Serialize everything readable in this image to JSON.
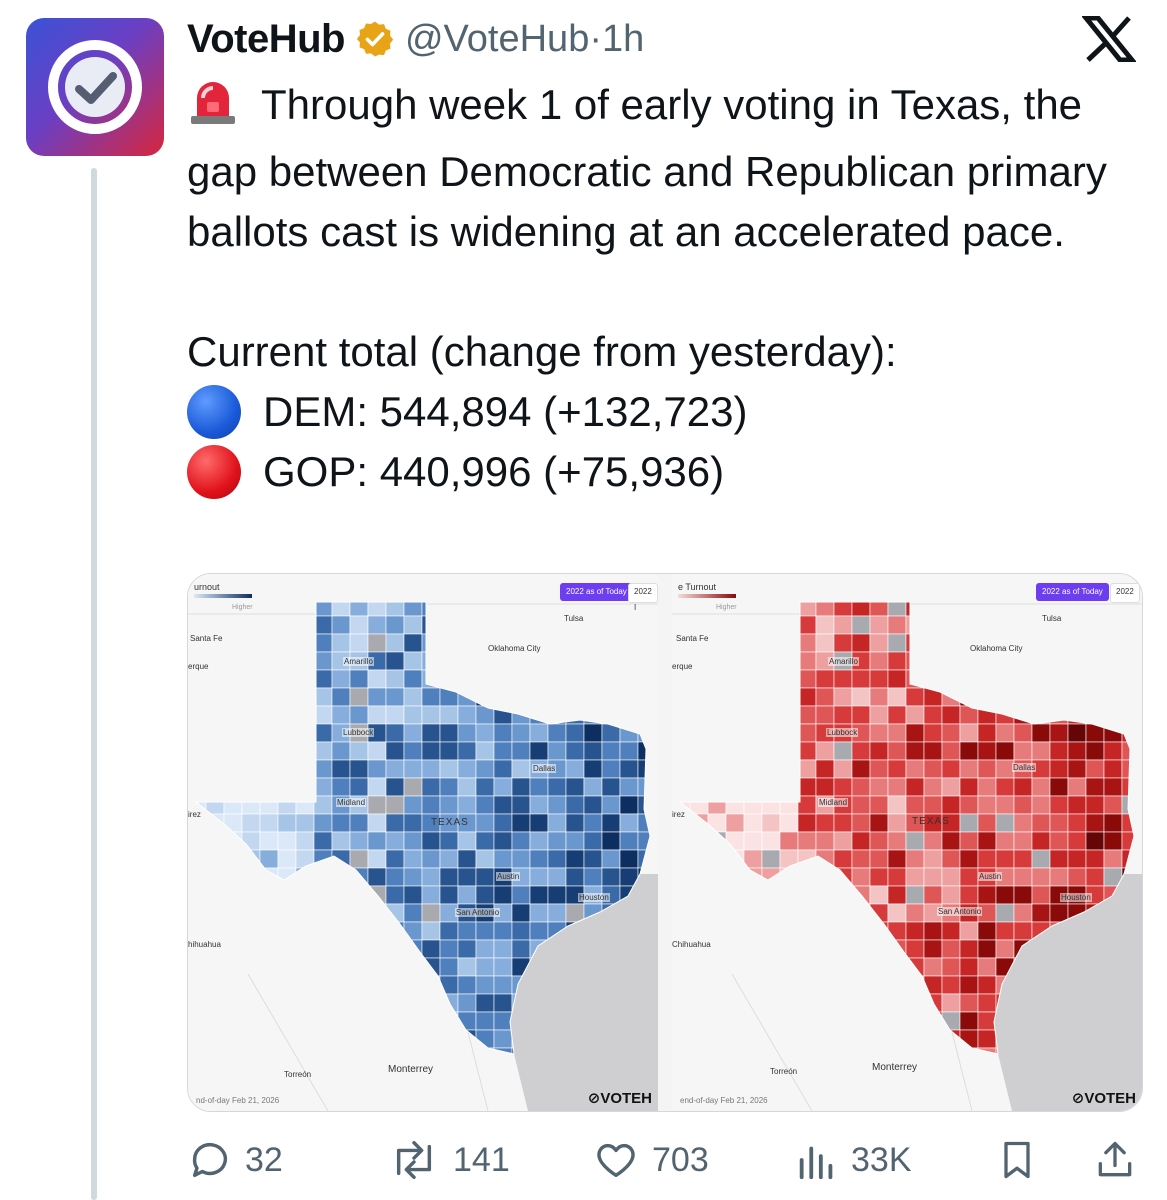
{
  "post": {
    "author_name": "VoteHub",
    "handle": "@VoteHub",
    "separator": "·",
    "time": "1h",
    "text_main": "Through week 1 of early voting in Texas, the gap between Democratic and Republican primary ballots cast is widening at an accelerated pace.",
    "totals_heading": "Current total (change from yesterday):",
    "dem_line": "DEM: 544,894 (+132,723)",
    "gop_line": "GOP: 440,996 (+75,936)"
  },
  "media": {
    "left": {
      "legend_title": "urnout",
      "legend_higher": "Higher",
      "pill_active": "2022 as of Today",
      "pill_next": "2022 I",
      "footer_date": "nd-of-day Feb 21, 2026",
      "brand": "VOTEH",
      "cities": {
        "tulsa": "Tulsa",
        "santa_fe": "Santa Fe",
        "erque": "erque",
        "okc": "Oklahoma City",
        "amarillo": "Amarillo",
        "lubbock": "Lubbock",
        "dallas": "Dallas",
        "midland": "Midland",
        "rez": "irez",
        "texas": "TEXAS",
        "austin": "Austin",
        "houston": "Houston",
        "san_antonio": "San Antonio",
        "chihuahua": "hihuahua",
        "torreon": "Torreón",
        "monterrey": "Monterrey"
      }
    },
    "right": {
      "legend_title": "e Turnout",
      "legend_higher": "Higher",
      "pill_active": "2022 as of Today",
      "pill_next": "2022",
      "footer_date": "end-of-day Feb 21, 2026",
      "brand": "VOTEH",
      "cities": {
        "tulsa": "Tulsa",
        "santa_fe": "Santa Fe",
        "erque": "erque",
        "okc": "Oklahoma City",
        "amarillo": "Amarillo",
        "lubbock": "Lubbock",
        "dallas": "Dallas",
        "midland": "Midland",
        "rez": "irez",
        "texas": "TEXAS",
        "austin": "Austin",
        "houston": "Houston",
        "san_antonio": "San Antonio",
        "chihuahua": "Chihuahua",
        "torreon": "Torreón",
        "monterrey": "Monterrey"
      }
    }
  },
  "actions": {
    "replies": "32",
    "reposts": "141",
    "likes": "703",
    "views": "33K"
  },
  "colors": {
    "accent_blue": "#1a5ad8",
    "accent_red": "#e0121b",
    "verified_gold": "#e8a317",
    "pill_purple": "#6d3df2",
    "icon_gray": "#536471"
  },
  "icons": [
    "votehub-logo-icon",
    "verified-badge-icon",
    "x-logo-icon",
    "siren-icon",
    "blue-circle-icon",
    "red-circle-icon",
    "reply-icon",
    "repost-icon",
    "like-icon",
    "views-icon",
    "bookmark-icon",
    "share-icon"
  ]
}
